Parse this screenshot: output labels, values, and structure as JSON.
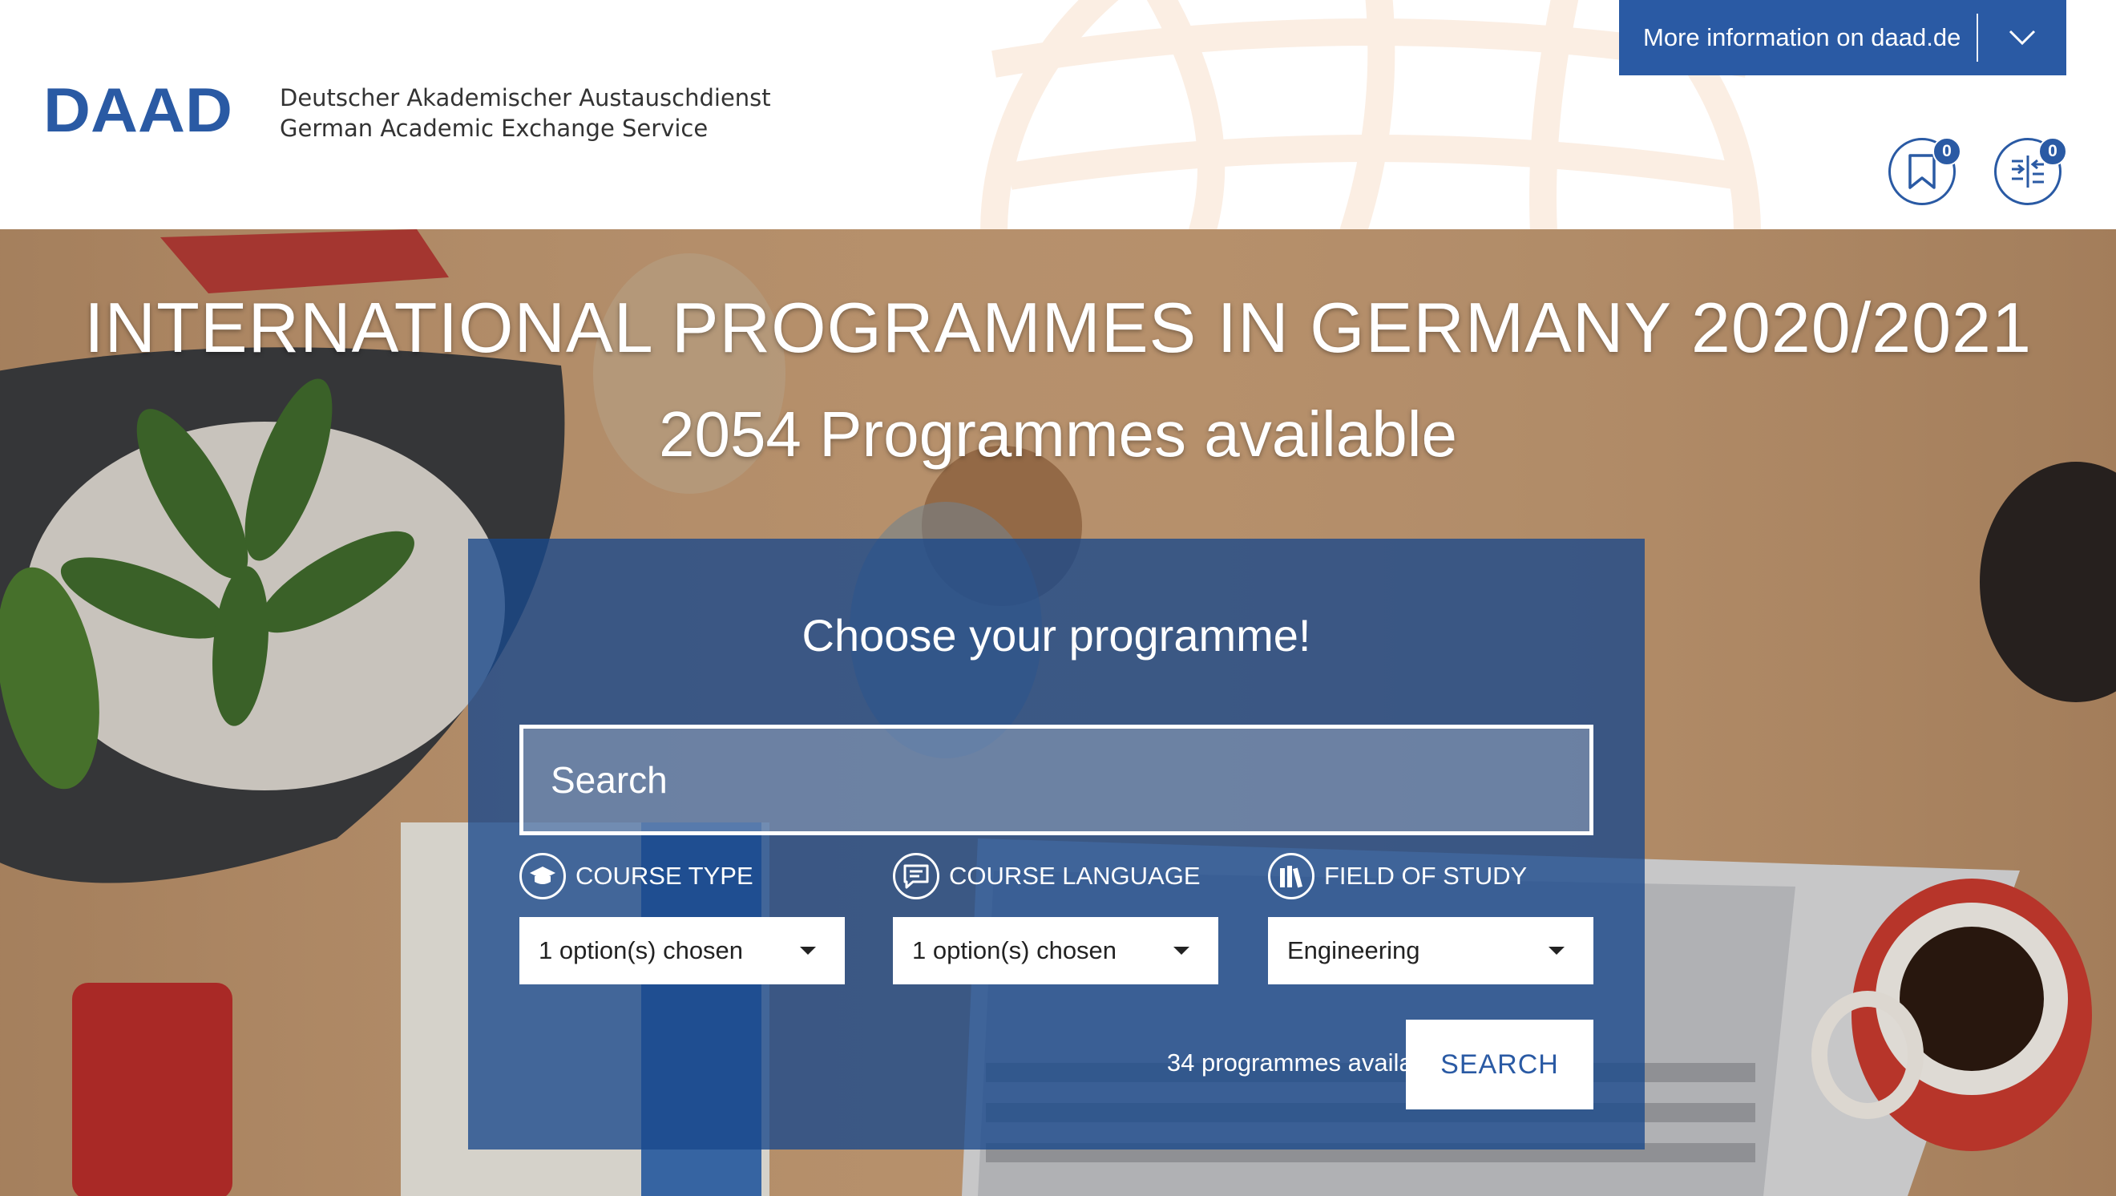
{
  "header": {
    "logo_text": "DAAD",
    "tagline_de": "Deutscher Akademischer Austauschdienst",
    "tagline_en": "German Academic Exchange Service",
    "more_info_label": "More information on daad.de",
    "bookmarks_count": "0",
    "compare_count": "0",
    "brand_color": "#2a5aa4"
  },
  "hero": {
    "title": "INTERNATIONAL PROGRAMMES IN GERMANY 2020/2021",
    "subtitle": "2054 Programmes available"
  },
  "search": {
    "heading": "Choose your programme!",
    "placeholder": "Search",
    "filters": [
      {
        "label": "COURSE TYPE",
        "icon": "graduation-cap-icon",
        "value": "1 option(s) chosen"
      },
      {
        "label": "COURSE LANGUAGE",
        "icon": "speech-bubble-icon",
        "value": "1 option(s) chosen"
      },
      {
        "label": "FIELD OF STUDY",
        "icon": "books-icon",
        "value": "Engineering"
      }
    ],
    "results_text": "34 programmes available",
    "button_label": "SEARCH"
  }
}
